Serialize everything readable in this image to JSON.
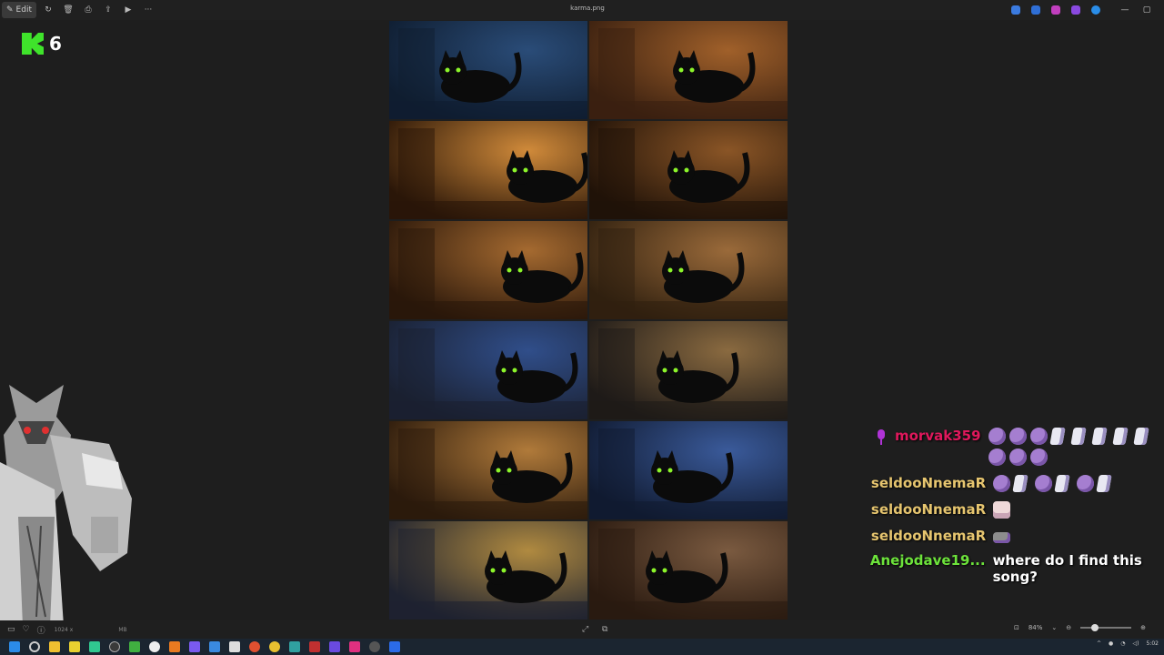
{
  "window": {
    "title": "karma.png",
    "edit_label": "Edit"
  },
  "toolbar": {
    "icons": [
      "edit-icon",
      "rotate-icon",
      "delete-icon",
      "print-icon",
      "share-icon",
      "slideshow-icon",
      "more-icon"
    ]
  },
  "overlay_counter": {
    "badge": "K",
    "count": "6",
    "accent": "#3fe32b"
  },
  "image": {
    "tiles": [
      {
        "scene": "cat-at-blue-window"
      },
      {
        "scene": "cat-lying-warm-floor"
      },
      {
        "scene": "cat-by-fireplace"
      },
      {
        "scene": "cat-on-robot-vacuum"
      },
      {
        "scene": "cat-crouching-near-vacuum"
      },
      {
        "scene": "cat-lying-rug"
      },
      {
        "scene": "cat-at-night-window"
      },
      {
        "scene": "cat-on-cushion"
      },
      {
        "scene": "cat-chasing-light"
      },
      {
        "scene": "cat-in-window-stars"
      },
      {
        "scene": "cat-walking-night"
      },
      {
        "scene": "cat-sleeping-bed"
      }
    ]
  },
  "chat": {
    "messages": [
      {
        "user": "morvak359",
        "color": "#e0185c",
        "badge": "mic-icon",
        "text": "",
        "emotes": [
          "ball",
          "ball",
          "ball",
          "flag",
          "flag",
          "flag",
          "flag",
          "flag",
          "ball",
          "ball",
          "ball"
        ]
      },
      {
        "user": "seldooNnemaR",
        "color": "#e6c56f",
        "text": "",
        "emotes": [
          "ball",
          "flag",
          "ball",
          "flag",
          "ball",
          "flag"
        ]
      },
      {
        "user": "seldooNnemaR",
        "color": "#e6c56f",
        "text": "",
        "emotes": [
          "girl"
        ]
      },
      {
        "user": "seldooNnemaR",
        "color": "#e6c56f",
        "text": "",
        "emotes": [
          "cat"
        ]
      },
      {
        "user": "Anejodave19...",
        "color": "#6de33b",
        "text": "where do I find this song?",
        "emotes": []
      }
    ]
  },
  "statusbar": {
    "dimensions": "1024 x",
    "size": "MB",
    "zoom": "84%"
  },
  "taskbar": {
    "time": "5:02"
  }
}
